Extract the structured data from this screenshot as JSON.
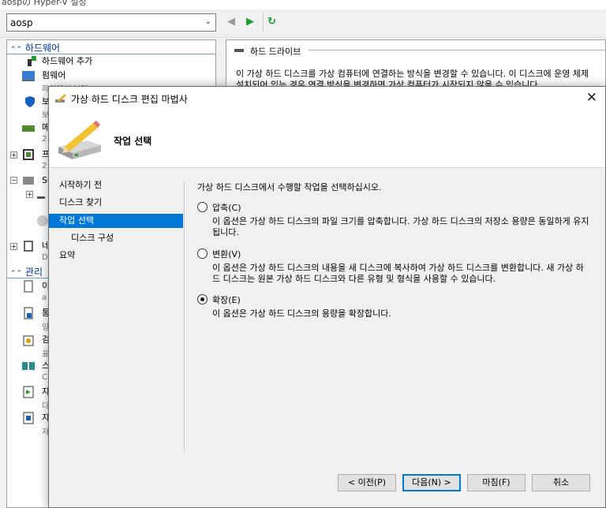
{
  "background": {
    "titlebar_text": "aospの Hyper-V 설정",
    "vm_name": "aosp",
    "left_pane": {
      "hardware_header": "하드웨어",
      "add_hardware": "하드웨어 추가",
      "firmware": "펌웨어",
      "firmware_sub": "파일에서 부팅",
      "security_label": "보",
      "security_sub": "보",
      "memory_label": "메",
      "memory_sub": "2",
      "processor_label": "프",
      "processor_sub": "2",
      "scsi_label": "SC",
      "network_label": "네",
      "network_sub": "D",
      "management_header": "관리",
      "mgmt_items": [
        "이",
        "통",
        "검",
        "스",
        "자",
        "자"
      ],
      "mgmt_subs": [
        "a",
        "일",
        "표",
        "C",
        "다",
        "저"
      ]
    },
    "right_pane": {
      "section_title": "하드 드라이브",
      "line1": "이 가상 하드 디스크를 가상 컴퓨터에 연결하는 방식을 변경할 수 있습니다. 이 디스크에 운영 체제",
      "line2": "설치되어 있는 경우 연결 방식을 변경하면 가상 컴퓨터가 시작되지 않을 수 있습니다."
    }
  },
  "dialog": {
    "title": "가상 하드 디스크 편집 마법사",
    "header_title": "작업 선택",
    "steps": [
      {
        "label": "시작하기 전",
        "active": false,
        "sub": false
      },
      {
        "label": "디스크 찾기",
        "active": false,
        "sub": false
      },
      {
        "label": "작업 선택",
        "active": true,
        "sub": false
      },
      {
        "label": "디스크 구성",
        "active": false,
        "sub": true
      },
      {
        "label": "요약",
        "active": false,
        "sub": false
      }
    ],
    "prompt": "가상 하드 디스크에서 수행할 작업을 선택하십시오.",
    "options": [
      {
        "label": "압축(C)",
        "desc": "이 옵션은 가상 하드 디스크의 파일 크기를 압축합니다. 가상 하드 디스크의 저장소 용량은 동일하게 유지됩니다.",
        "selected": false
      },
      {
        "label": "변환(V)",
        "desc": "이 옵션은 가상 하드 디스크의 내용을 새 디스크에 복사하여 가상 하드 디스크를 변환합니다. 새 가상 하드 디스크는 원본 가상 하드 디스크와 다른 유형 및 형식을 사용할 수 있습니다.",
        "selected": false
      },
      {
        "label": "확장(E)",
        "desc": "이 옵션은 가상 하드 디스크의 용량을 확장합니다.",
        "selected": true
      }
    ],
    "buttons": {
      "prev": "< 이전(P)",
      "next": "다음(N) >",
      "finish": "마침(F)",
      "cancel": "취소"
    }
  },
  "colors": {
    "accent": "#0078d7",
    "section_header": "#003399"
  }
}
